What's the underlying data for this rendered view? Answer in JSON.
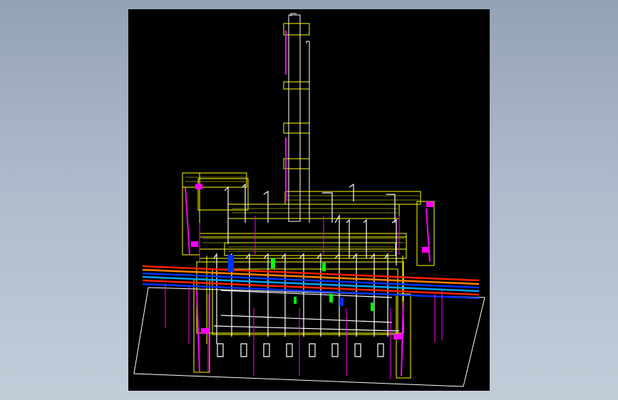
{
  "viewport": {
    "background": "#000000",
    "model": "plant-piping-3d-wireframe"
  },
  "colors": {
    "structure": "#ffff00",
    "piping": "#ffffff",
    "supports": "#ff00ff",
    "pipe_red": "#ff2000",
    "pipe_orange": "#ff8000",
    "pipe_blue": "#0030ff",
    "pipe_cyan": "#00a0ff",
    "valves_green": "#00ff00",
    "ground_outline": "#ffffff"
  }
}
